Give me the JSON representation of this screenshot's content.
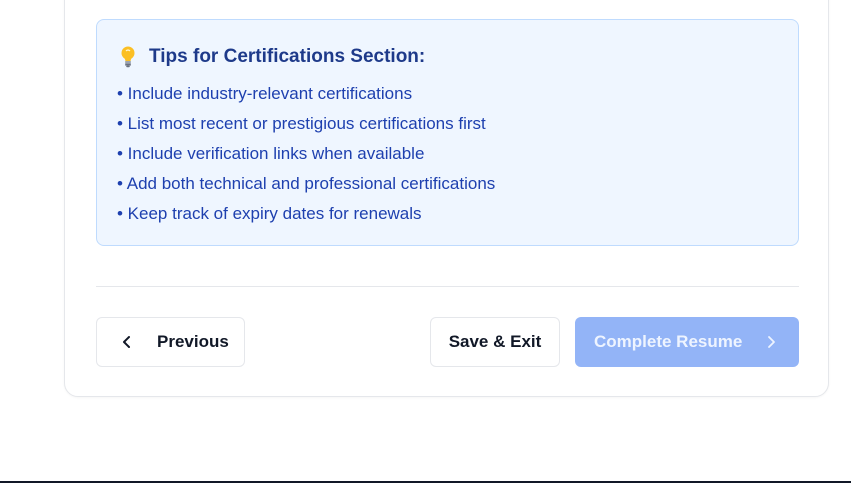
{
  "tips": {
    "icon": "lightbulb-icon",
    "title": "Tips for Certifications Section:",
    "items": [
      "• Include industry-relevant certifications",
      "• List most recent or prestigious certifications first",
      "• Include verification links when available",
      "• Add both technical and professional certifications",
      "• Keep track of expiry dates for renewals"
    ]
  },
  "navigation": {
    "previous_label": "Previous",
    "previous_icon": "chevron-left-icon",
    "save_exit_label": "Save & Exit",
    "complete_label": "Complete Resume",
    "complete_icon": "chevron-right-icon",
    "complete_disabled": true
  },
  "colors": {
    "tips_background": "#eff6ff",
    "tips_border": "#bfdbfe",
    "tips_text": "#1e40af",
    "complete_button_bg": "#93b4f7"
  }
}
